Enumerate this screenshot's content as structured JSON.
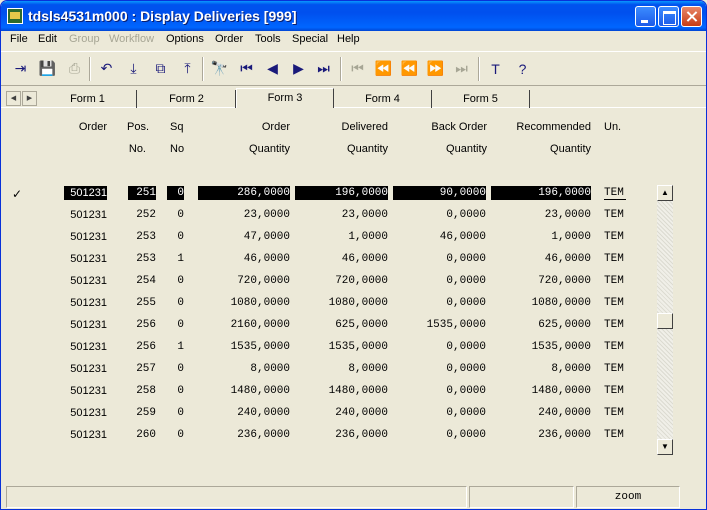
{
  "window": {
    "title": "tdsls4531m000 : Display Deliveries [999]"
  },
  "menu": [
    {
      "label": "File",
      "disabled": false
    },
    {
      "label": "Edit",
      "disabled": false
    },
    {
      "label": "Group",
      "disabled": true
    },
    {
      "label": "Workflow",
      "disabled": true
    },
    {
      "label": "Options",
      "disabled": false
    },
    {
      "label": "Order",
      "disabled": false
    },
    {
      "label": "Tools",
      "disabled": false
    },
    {
      "label": "Special",
      "disabled": false
    },
    {
      "label": "Help",
      "disabled": false
    }
  ],
  "toolbar": {
    "buttons": [
      {
        "icon": "exit-icon",
        "glyph": "⇥"
      },
      {
        "icon": "save-icon",
        "glyph": "💾"
      },
      {
        "icon": "print-icon",
        "glyph": "⎙",
        "disabled": true
      },
      {
        "icon": "undo-icon",
        "glyph": "↶"
      },
      {
        "icon": "import-icon",
        "glyph": "⤓"
      },
      {
        "icon": "copy-icon",
        "glyph": "⧉"
      },
      {
        "icon": "export-icon",
        "glyph": "⤒"
      },
      {
        "icon": "find-icon",
        "glyph": "🔭"
      },
      {
        "icon": "first-record-icon",
        "glyph": "⏮"
      },
      {
        "icon": "previous-record-icon",
        "glyph": "◀"
      },
      {
        "icon": "next-record-icon",
        "glyph": "▶"
      },
      {
        "icon": "last-record-icon",
        "glyph": "⏭"
      },
      {
        "icon": "first-set-icon",
        "glyph": "⏮",
        "disabled": true
      },
      {
        "icon": "previous-set-icon",
        "glyph": "⏪",
        "disabled": true
      },
      {
        "icon": "rewind-icon",
        "glyph": "⏪",
        "disabled": true
      },
      {
        "icon": "forward-icon",
        "glyph": "⏩",
        "disabled": true
      },
      {
        "icon": "last-set-icon",
        "glyph": "⏭",
        "disabled": true
      },
      {
        "icon": "text-icon",
        "glyph": "T"
      },
      {
        "icon": "whats-this-icon",
        "glyph": "?"
      }
    ]
  },
  "tabs": [
    "Form 1",
    "Form 2",
    "Form 3",
    "Form 4",
    "Form 5"
  ],
  "active_tab": 2,
  "headers": {
    "order": "Order",
    "pos": [
      "Pos.",
      "No."
    ],
    "sq": [
      "Sq",
      "No"
    ],
    "order_qty": [
      "Order",
      "Quantity"
    ],
    "delivered": [
      "Delivered",
      "Quantity"
    ],
    "back_order": [
      "Back Order",
      "Quantity"
    ],
    "recommended": [
      "Recommended",
      "Quantity"
    ],
    "unit": "Un."
  },
  "rows": [
    {
      "order": "501231",
      "pos": "251",
      "sq": "0",
      "order_qty": "286,0000",
      "delivered": "196,0000",
      "back_order": "90,0000",
      "recommended": "196,0000",
      "unit": "TEM",
      "selected": true,
      "check": "✓"
    },
    {
      "order": "501231",
      "pos": "252",
      "sq": "0",
      "order_qty": "23,0000",
      "delivered": "23,0000",
      "back_order": "0,0000",
      "recommended": "23,0000",
      "unit": "TEM"
    },
    {
      "order": "501231",
      "pos": "253",
      "sq": "0",
      "order_qty": "47,0000",
      "delivered": "1,0000",
      "back_order": "46,0000",
      "recommended": "1,0000",
      "unit": "TEM"
    },
    {
      "order": "501231",
      "pos": "253",
      "sq": "1",
      "order_qty": "46,0000",
      "delivered": "46,0000",
      "back_order": "0,0000",
      "recommended": "46,0000",
      "unit": "TEM"
    },
    {
      "order": "501231",
      "pos": "254",
      "sq": "0",
      "order_qty": "720,0000",
      "delivered": "720,0000",
      "back_order": "0,0000",
      "recommended": "720,0000",
      "unit": "TEM"
    },
    {
      "order": "501231",
      "pos": "255",
      "sq": "0",
      "order_qty": "1080,0000",
      "delivered": "1080,0000",
      "back_order": "0,0000",
      "recommended": "1080,0000",
      "unit": "TEM"
    },
    {
      "order": "501231",
      "pos": "256",
      "sq": "0",
      "order_qty": "2160,0000",
      "delivered": "625,0000",
      "back_order": "1535,0000",
      "recommended": "625,0000",
      "unit": "TEM"
    },
    {
      "order": "501231",
      "pos": "256",
      "sq": "1",
      "order_qty": "1535,0000",
      "delivered": "1535,0000",
      "back_order": "0,0000",
      "recommended": "1535,0000",
      "unit": "TEM"
    },
    {
      "order": "501231",
      "pos": "257",
      "sq": "0",
      "order_qty": "8,0000",
      "delivered": "8,0000",
      "back_order": "0,0000",
      "recommended": "8,0000",
      "unit": "TEM"
    },
    {
      "order": "501231",
      "pos": "258",
      "sq": "0",
      "order_qty": "1480,0000",
      "delivered": "1480,0000",
      "back_order": "0,0000",
      "recommended": "1480,0000",
      "unit": "TEM"
    },
    {
      "order": "501231",
      "pos": "259",
      "sq": "0",
      "order_qty": "240,0000",
      "delivered": "240,0000",
      "back_order": "0,0000",
      "recommended": "240,0000",
      "unit": "TEM"
    },
    {
      "order": "501231",
      "pos": "260",
      "sq": "0",
      "order_qty": "236,0000",
      "delivered": "236,0000",
      "back_order": "0,0000",
      "recommended": "236,0000",
      "unit": "TEM"
    }
  ],
  "status": {
    "zoom": "zoom"
  },
  "colors": {
    "titlebar": "#0053ee",
    "selection": "#000000",
    "background": "#ece9d8"
  }
}
